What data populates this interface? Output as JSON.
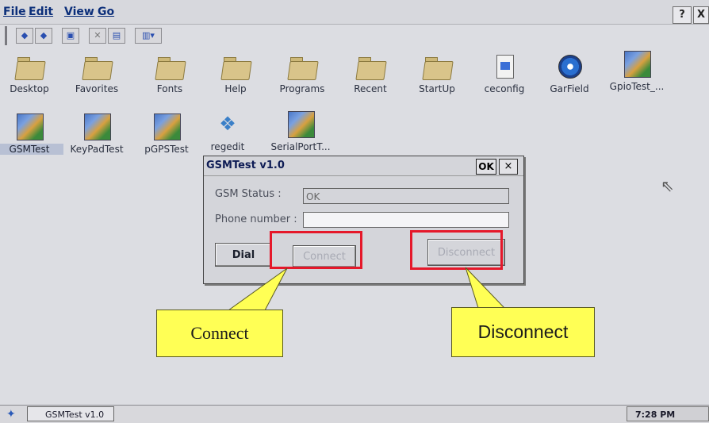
{
  "menubar": {
    "items": [
      "File",
      "Edit",
      "View",
      "Go"
    ],
    "help_label": "?",
    "close_label": "X"
  },
  "toolbar": {
    "buttons": [
      "back-icon",
      "forward-icon",
      "up-folder-icon",
      "delete-icon",
      "properties-icon",
      "view-menu-icon"
    ]
  },
  "desktop": {
    "row1": [
      {
        "label": "Desktop",
        "icon": "folder-icon"
      },
      {
        "label": "Favorites",
        "icon": "folder-icon"
      },
      {
        "label": "Fonts",
        "icon": "folder-icon"
      },
      {
        "label": "Help",
        "icon": "folder-icon"
      },
      {
        "label": "Programs",
        "icon": "folder-icon"
      },
      {
        "label": "Recent",
        "icon": "folder-icon"
      },
      {
        "label": "StartUp",
        "icon": "folder-icon"
      },
      {
        "label": "ceconfig",
        "icon": "config-icon"
      },
      {
        "label": "GarField",
        "icon": "garfield-icon"
      },
      {
        "label": "GpioTest_...",
        "icon": "app-cubes-icon"
      }
    ],
    "row2": [
      {
        "label": "GSMTest",
        "icon": "app-cubes-icon",
        "selected": true
      },
      {
        "label": "KeyPadTest",
        "icon": "app-cubes-icon"
      },
      {
        "label": "pGPSTest",
        "icon": "app-cubes-icon"
      },
      {
        "label": "regedit",
        "icon": "registry-icon"
      },
      {
        "label": "SerialPortT...",
        "icon": "app-cubes-icon"
      }
    ]
  },
  "dialog": {
    "title": "GSMTest v1.0",
    "ok_label": "OK",
    "close_label": "×",
    "gsm_status_label": "GSM Status :",
    "gsm_status_value": "OK",
    "phone_label": "Phone number :",
    "phone_value": "",
    "dial_label": "Dial",
    "connect_label": "Connect",
    "disconnect_label": "Disconnect"
  },
  "callouts": {
    "connect": "Connect",
    "disconnect": "Disconnect",
    "highlight_color": "#e5182a",
    "callout_color": "#ffff55"
  },
  "taskbar": {
    "task_label": "GSMTest v1.0",
    "time": "7:28 PM"
  }
}
